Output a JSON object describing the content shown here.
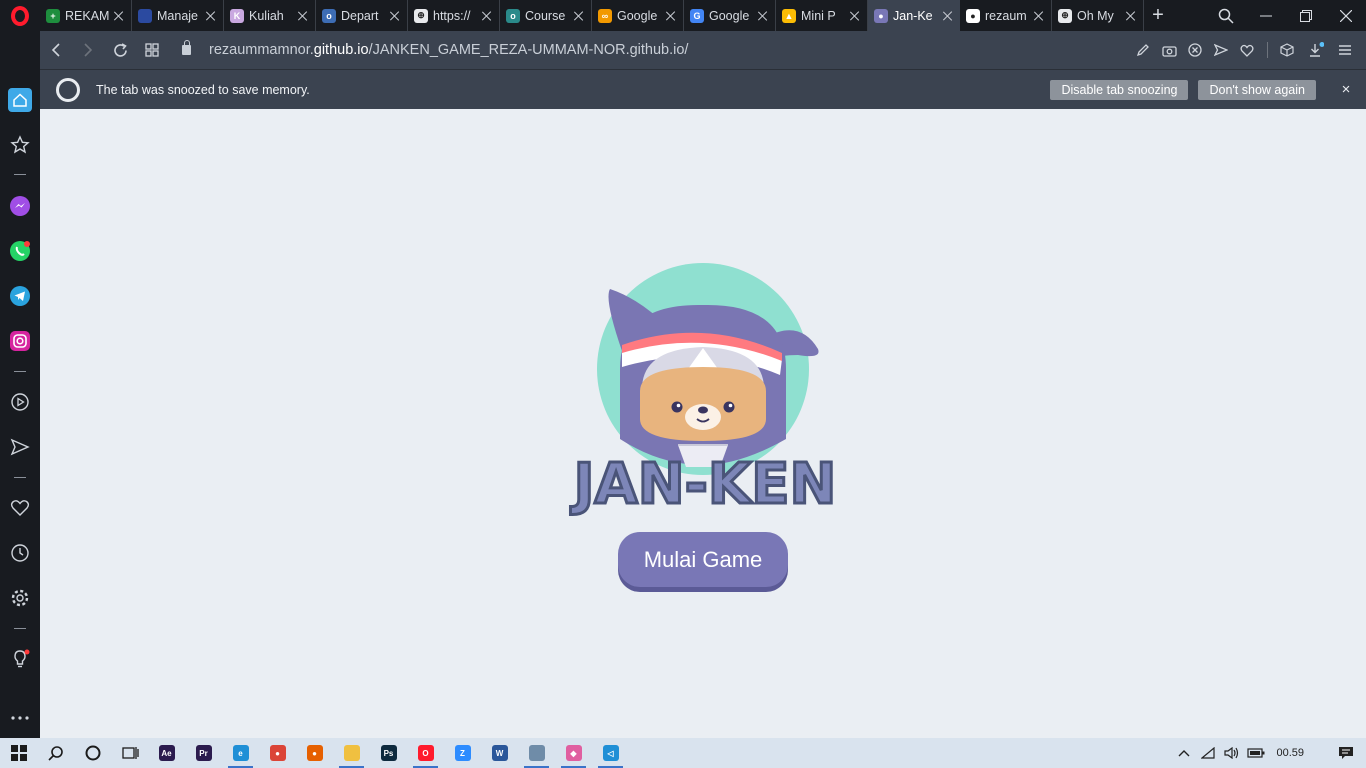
{
  "tabs": [
    {
      "title": "REKAM",
      "fav_color": "#1e8e3e",
      "fav_glyph": "+"
    },
    {
      "title": "Manaje",
      "fav_color": "#2b4aa0",
      "fav_glyph": ""
    },
    {
      "title": "Kuliah",
      "fav_color": "#c9a8e0",
      "fav_glyph": "K"
    },
    {
      "title": "Depart",
      "fav_color": "#3d6db5",
      "fav_glyph": "o"
    },
    {
      "title": "https://",
      "fav_color": "#e8eaed",
      "fav_glyph": "⊕"
    },
    {
      "title": "Course",
      "fav_color": "#2a8a8a",
      "fav_glyph": "o"
    },
    {
      "title": "Google",
      "fav_color": "#f29900",
      "fav_glyph": "∞"
    },
    {
      "title": "Google",
      "fav_color": "#4285f4",
      "fav_glyph": "G"
    },
    {
      "title": "Mini P",
      "fav_color": "#fbbc04",
      "fav_glyph": "▲"
    },
    {
      "title": "Jan-Ke",
      "fav_color": "#7977b6",
      "fav_glyph": "●",
      "active": true
    },
    {
      "title": "rezaum",
      "fav_color": "#ffffff",
      "fav_glyph": "●"
    },
    {
      "title": "Oh My",
      "fav_color": "#e8eaed",
      "fav_glyph": "⊕"
    }
  ],
  "address": {
    "domain_pre": "rezaummamnor.",
    "domain_main": "github.io",
    "path": "/JANKEN_GAME_REZA-UMMAM-NOR.github.io/"
  },
  "infobar": {
    "message": "The tab was snoozed to save memory.",
    "disable_label": "Disable tab snoozing",
    "dont_show_label": "Don't show again",
    "close_glyph": "×"
  },
  "game": {
    "title": "JAN-KEN",
    "start_label": "Mulai Game"
  },
  "colors": {
    "accent": "#7977b6",
    "circle": "#8fe0d0",
    "headband_red": "#ff7a80",
    "face": "#e8b47e",
    "title_fill": "#7d86b8",
    "title_stroke": "#4a5478"
  },
  "taskbar": {
    "clock": "00.59",
    "apps": [
      {
        "name": "ae",
        "color": "#2b1b4e",
        "glyph": "Ae"
      },
      {
        "name": "pr",
        "color": "#2b1b4e",
        "glyph": "Pr"
      },
      {
        "name": "edge",
        "color": "#1f8fd6",
        "glyph": "e"
      },
      {
        "name": "chrome",
        "color": "#db4437",
        "glyph": "●"
      },
      {
        "name": "firefox",
        "color": "#e66000",
        "glyph": "●"
      },
      {
        "name": "explorer",
        "color": "#f0c040",
        "glyph": ""
      },
      {
        "name": "ps",
        "color": "#0e2a3e",
        "glyph": "Ps"
      },
      {
        "name": "opera",
        "color": "#ff1b2d",
        "glyph": "O"
      },
      {
        "name": "zoom",
        "color": "#2d8cff",
        "glyph": "Z"
      },
      {
        "name": "word",
        "color": "#2b579a",
        "glyph": "W"
      },
      {
        "name": "notepad",
        "color": "#6f8ca8",
        "glyph": ""
      },
      {
        "name": "app",
        "color": "#e05fa0",
        "glyph": "◆"
      },
      {
        "name": "vscode",
        "color": "#1f8fd6",
        "glyph": "◁"
      }
    ]
  }
}
